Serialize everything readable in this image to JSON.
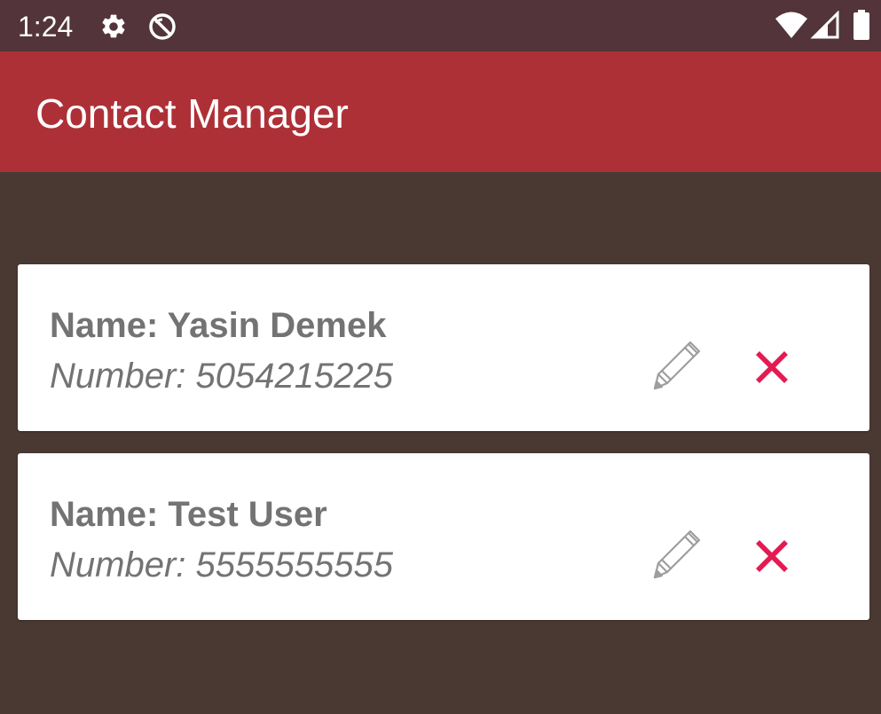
{
  "status_bar": {
    "time": "1:24",
    "icons": [
      "gear-icon",
      "no-sync-icon",
      "wifi-icon",
      "signal-icon",
      "battery-icon"
    ]
  },
  "app_bar": {
    "title": "Contact Manager",
    "color": "#ae3037"
  },
  "colors": {
    "background": "#4a3833",
    "status_bar": "#52343a",
    "card": "#ffffff",
    "text": "#737373",
    "delete": "#e31b52"
  },
  "contacts": [
    {
      "name": "Name: Yasin Demek",
      "number": "Number: 5054215225",
      "edit_icon": "pencil-icon",
      "delete_icon": "close-icon"
    },
    {
      "name": "Name: Test User",
      "number": "Number: 5555555555",
      "edit_icon": "pencil-icon",
      "delete_icon": "close-icon"
    }
  ]
}
